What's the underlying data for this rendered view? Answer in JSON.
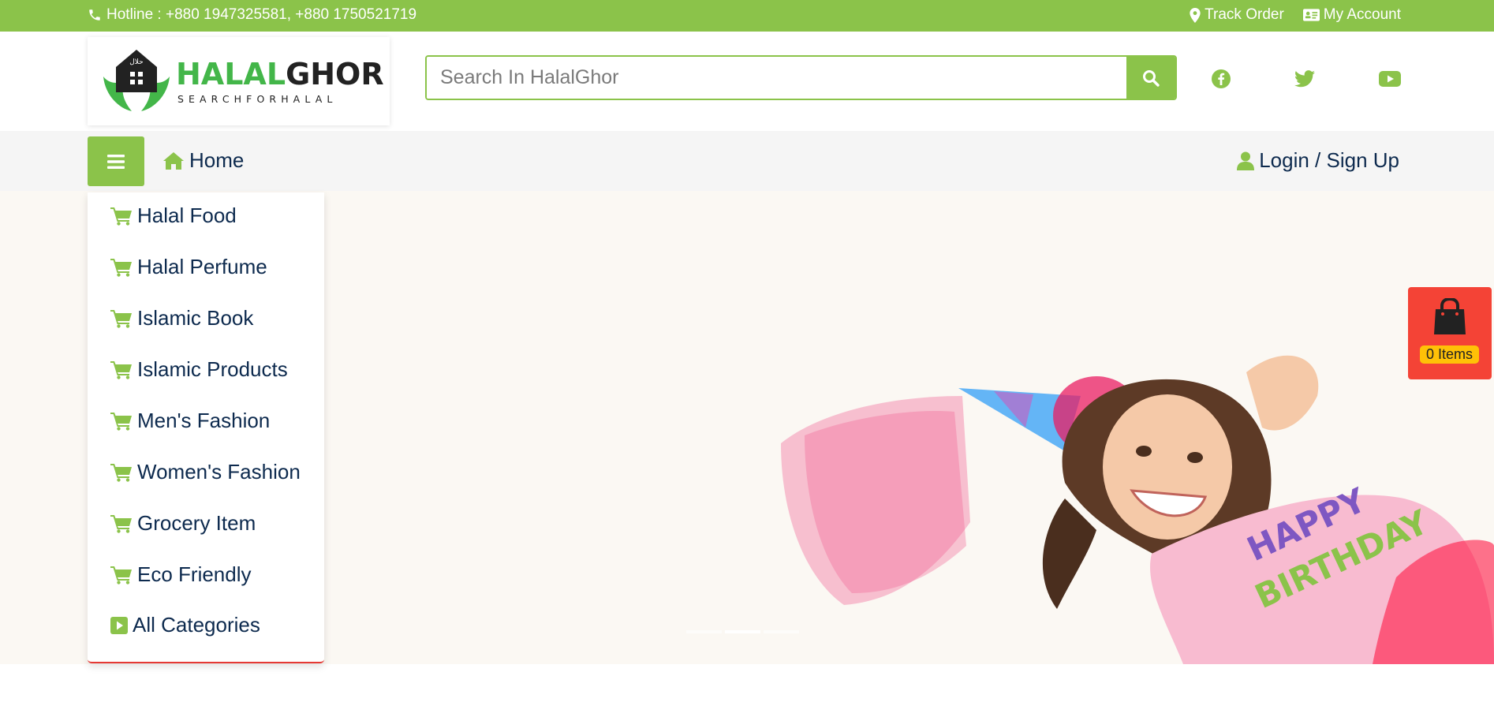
{
  "topbar": {
    "hotline": "Hotline : +880 1947325581, +880 1750521719",
    "track_order": "Track Order",
    "my_account": "My Account"
  },
  "header": {
    "logo_primary": "HALAL",
    "logo_secondary": "GHOR",
    "logo_tagline": "SEARCHFORHALAL",
    "search_placeholder": "Search In HalalGhor",
    "social_icons": [
      "facebook-icon",
      "twitter-icon",
      "youtube-icon"
    ]
  },
  "nav": {
    "home": "Home",
    "login": "Login / Sign Up"
  },
  "categories": [
    "Halal Food",
    "Halal Perfume",
    "Islamic Book",
    "Islamic Products",
    "Men's Fashion",
    "Women's Fashion",
    "Grocery Item",
    "Eco Friendly",
    "All Categories"
  ],
  "cart": {
    "count_label": "0 Items"
  },
  "colors": {
    "brand_green": "#8bc34a",
    "logo_green": "#43b649",
    "text_navy": "#0d2a4e",
    "cart_red": "#f44336",
    "badge_yellow": "#ffc107",
    "hero_bg": "#fbf8f3"
  }
}
